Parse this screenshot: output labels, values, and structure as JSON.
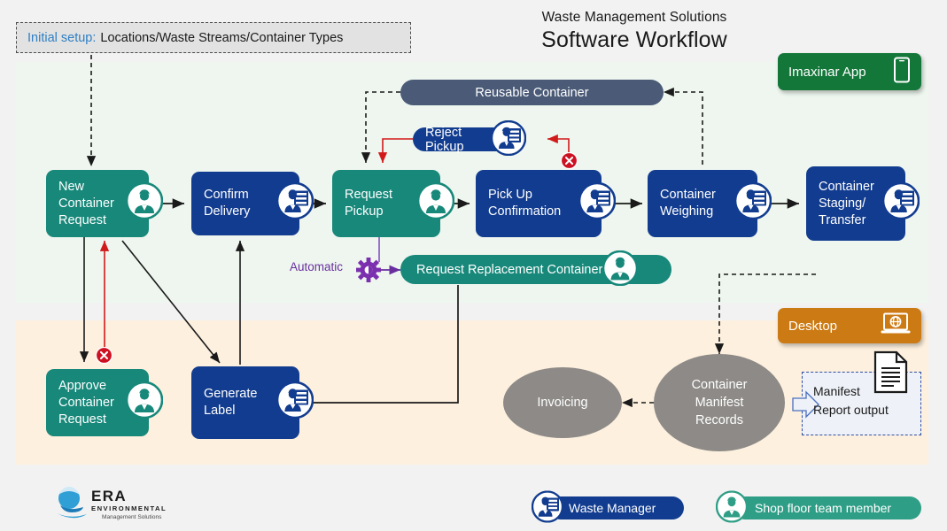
{
  "title": {
    "subtitle": "Waste Management Solutions",
    "main": "Software Workflow"
  },
  "initial_setup": {
    "label": "Initial setup:",
    "value": "Locations/Waste Streams/Container Types",
    "label_color": "#2f7fc4"
  },
  "badges": [
    {
      "id": "imaxinar-app",
      "label": "Imaxinar App",
      "icon": "smartphone-icon",
      "color": "#13773a"
    },
    {
      "id": "desktop",
      "label": "Desktop",
      "icon": "laptop-globe-icon",
      "color": "#cc7a14"
    }
  ],
  "bands": [
    {
      "id": "app-band",
      "color": "#eef6ef"
    },
    {
      "id": "desktop-band",
      "color": "#fdf0de"
    }
  ],
  "nodes": [
    {
      "id": "new-container-request",
      "label": "New\nContainer\nRequest",
      "role": "shop-floor",
      "color": "#17887a"
    },
    {
      "id": "confirm-delivery",
      "label": "Confirm\nDelivery",
      "role": "waste-manager",
      "color": "#123c8f"
    },
    {
      "id": "request-pickup",
      "label": "Request\nPickup",
      "role": "shop-floor",
      "color": "#17887a"
    },
    {
      "id": "pick-up-confirmation",
      "label": "Pick Up\nConfirmation",
      "role": "waste-manager",
      "color": "#123c8f"
    },
    {
      "id": "container-weighing",
      "label": "Container\nWeighing",
      "role": "waste-manager",
      "color": "#123c8f"
    },
    {
      "id": "container-staging-transfer",
      "label": "Container\nStaging/\nTransfer",
      "role": "waste-manager",
      "color": "#123c8f"
    },
    {
      "id": "approve-container-request",
      "label": "Approve\nContainer\nRequest",
      "role": "shop-floor",
      "color": "#17887a"
    },
    {
      "id": "generate-label",
      "label": "Generate\nLabel",
      "role": "waste-manager",
      "color": "#123c8f"
    }
  ],
  "pills": [
    {
      "id": "reusable-container",
      "label": "Reusable Container",
      "color": "#4a5a77",
      "has_avatar": false
    },
    {
      "id": "reject-pickup",
      "label": "Reject Pickup",
      "color": "#123c8f",
      "has_avatar": true,
      "role": "waste-manager"
    },
    {
      "id": "request-replacement-container",
      "label": "Request Replacement Container",
      "color": "#17887a",
      "has_avatar": true,
      "role": "shop-floor"
    }
  ],
  "automatic": {
    "label": "Automatic",
    "icon": "gear-icon",
    "color": "#6a2f9e"
  },
  "ellipses": [
    {
      "id": "invoicing",
      "label": "Invoicing",
      "color": "#8d8a87"
    },
    {
      "id": "container-manifest-records",
      "label": "Container\nManifest\nRecords",
      "color": "#8d8a87"
    }
  ],
  "manifest_output": {
    "id": "manifest-report-output",
    "label": "Manifest\nReport output",
    "icon": "document-icon",
    "arrow_icon": "block-arrow-right-icon",
    "border_color": "#2f4f9e"
  },
  "markers": [
    {
      "id": "reject-x-top",
      "icon": "x-circle-icon",
      "color": "#cc1122"
    },
    {
      "id": "reject-x-bottom",
      "icon": "x-circle-icon",
      "color": "#cc1122"
    }
  ],
  "logo": {
    "name": "ERA",
    "line2": "ENVIRONMENTAL",
    "line3": "Management Solutions",
    "icon": "globe-icon"
  },
  "legend": [
    {
      "id": "waste-manager",
      "label": "Waste Manager",
      "color": "#123c8f",
      "icon": "waste-manager-icon"
    },
    {
      "id": "shop-floor-team",
      "label": "Shop floor team member",
      "color": "#2f9e86",
      "icon": "shop-floor-icon"
    }
  ]
}
